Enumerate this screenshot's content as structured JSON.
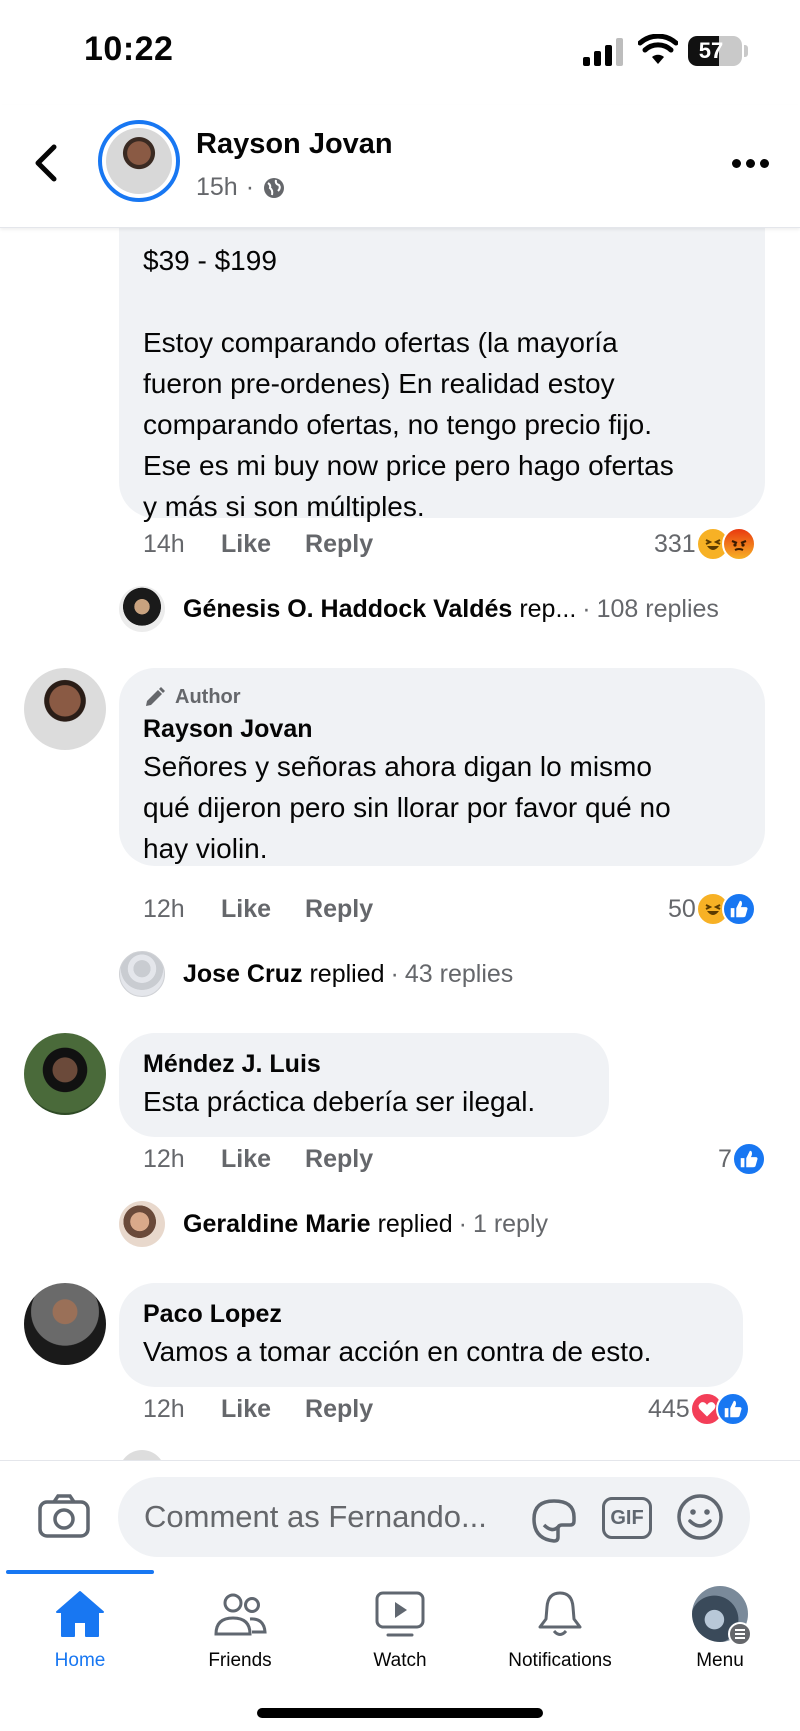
{
  "status_bar": {
    "time": "10:22",
    "battery": "57",
    "battery_level": 0.57
  },
  "header": {
    "name": "Rayson Jovan",
    "time": "15h",
    "separator": "·",
    "audience_icon": "globe-icon"
  },
  "comments": [
    {
      "id": "c1",
      "text_lines": [
        "$39 - $199",
        "",
        "Estoy comparando ofertas (la mayoría",
        "fueron pre-ordenes) En realidad estoy",
        "comparando ofertas, no tengo precio fijo.",
        "Ese es mi buy now price pero hago ofertas",
        "y más si son múltiples."
      ],
      "time": "14h",
      "like_label": "Like",
      "reply_label": "Reply",
      "reaction_count": "331",
      "reactions": [
        "haha",
        "angry"
      ],
      "replied": {
        "name": "Génesis O. Haddock Valdés",
        "verb": "rep...",
        "count": "108 replies"
      }
    },
    {
      "id": "c2",
      "badge": "Author",
      "author": "Rayson Jovan",
      "text_lines": [
        "Señores y señoras ahora digan lo mismo",
        "qué dijeron pero sin llorar por favor qué no",
        "hay violin."
      ],
      "time": "12h",
      "like_label": "Like",
      "reply_label": "Reply",
      "reaction_count": "50",
      "reactions": [
        "haha",
        "like"
      ],
      "replied": {
        "name": "Jose Cruz",
        "verb": "replied",
        "count": "43 replies"
      }
    },
    {
      "id": "c3",
      "author": "Méndez J. Luis",
      "text_lines": [
        "Esta práctica debería ser ilegal."
      ],
      "time": "12h",
      "like_label": "Like",
      "reply_label": "Reply",
      "reaction_count": "7",
      "reactions": [
        "like"
      ],
      "replied": {
        "name": "Geraldine Marie",
        "verb": "replied",
        "count": "1 reply"
      }
    },
    {
      "id": "c4",
      "author": "Paco Lopez",
      "text_lines": [
        "Vamos a tomar acción en contra de esto."
      ],
      "time": "12h",
      "like_label": "Like",
      "reply_label": "Reply",
      "reaction_count": "445",
      "reactions": [
        "love",
        "like"
      ]
    }
  ],
  "composer": {
    "placeholder": "Comment as Fernando...",
    "gif_label": "GIF"
  },
  "nav": {
    "items": [
      {
        "label": "Home",
        "icon": "home-icon",
        "active": true
      },
      {
        "label": "Friends",
        "icon": "friends-icon"
      },
      {
        "label": "Watch",
        "icon": "watch-icon"
      },
      {
        "label": "Notifications",
        "icon": "bell-icon"
      },
      {
        "label": "Menu",
        "icon": "menu-avatar-icon"
      }
    ]
  },
  "colors": {
    "accent": "#1877f2",
    "bubble": "#f0f2f5",
    "muted": "#65676b",
    "haha": "#f7b125",
    "angry": "#e9710f",
    "love": "#f33e58"
  }
}
